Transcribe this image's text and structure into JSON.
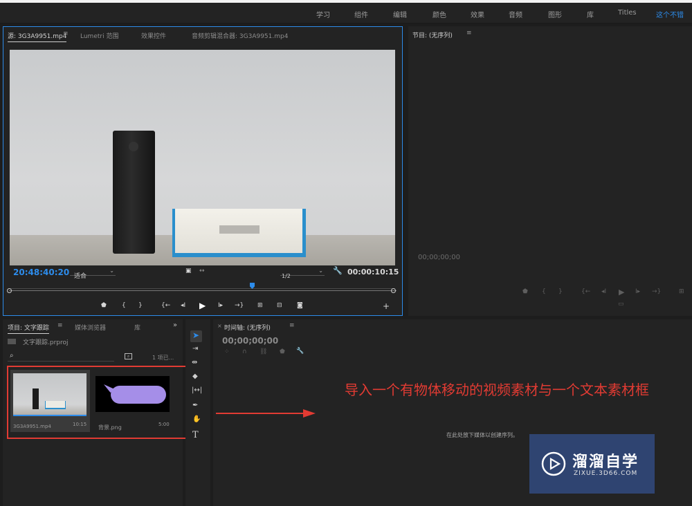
{
  "workspaces": [
    "学习",
    "组件",
    "编辑",
    "颜色",
    "效果",
    "音频",
    "图形",
    "库",
    "Titles",
    "这个不错"
  ],
  "source": {
    "tabs": [
      "源: 3G3A9951.mp4",
      "Lumetri 范围",
      "效果控件",
      "音频剪辑混合器: 3G3A9951.mp4"
    ],
    "timecode_current": "20:48:40:20",
    "fit": "适合",
    "resolution": "1/2",
    "timecode_duration": "00:00:10:15"
  },
  "program": {
    "tab": "节目: (无序列)",
    "timecode": "00;00;00;00"
  },
  "project": {
    "tabs": [
      "项目: 文字跟踪",
      "媒体浏览器",
      "库"
    ],
    "file": "文字跟踪.prproj",
    "item_count": "1 项已...",
    "search_placeholder": "",
    "items": [
      {
        "name": "3G3A9951.mp4",
        "duration": "10:15"
      },
      {
        "name": "背景.png",
        "duration": "5:00"
      }
    ]
  },
  "timeline": {
    "tab": "时间轴: (无序列)",
    "timecode": "00;00;00;00",
    "drop_hint": "在此处放下媒体以创建序列。"
  },
  "annotation": "导入一个有物体移动的视频素材与一个文本素材框",
  "watermark": {
    "title": "溜溜自学",
    "url": "ZIXUE.3D66.COM"
  },
  "colors": {
    "accent": "#2d8ceb",
    "annotation": "#e23b33",
    "watermark_bg": "#2f4471"
  }
}
